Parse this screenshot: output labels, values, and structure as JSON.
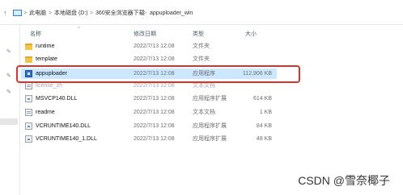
{
  "breadcrumb": [
    "此电脑",
    "本地磁盘 (D:)",
    "360安全浏览器下载",
    "appuploader_win"
  ],
  "breadcrumb_separator": ">",
  "columns": {
    "name": "名称",
    "date": "修改日期",
    "type": "类型",
    "size": "大小"
  },
  "files": [
    {
      "name": "runtime",
      "date": "2022/7/13 12:08",
      "type": "文件夹",
      "size": "",
      "icon": "folder-icon"
    },
    {
      "name": "template",
      "date": "2022/7/13 12:08",
      "type": "文件夹",
      "size": "",
      "icon": "folder-icon"
    },
    {
      "name": "appuploader",
      "date": "2022/7/13 12:08",
      "type": "应用程序",
      "size": "112,906 KB",
      "icon": "application-icon",
      "selected": true
    },
    {
      "name": "license_zh",
      "date": "2022/7/13 12:08",
      "type": "文本文档",
      "size": "",
      "icon": "text-file-icon",
      "faded": true
    },
    {
      "name": "MSVCP140.DLL",
      "date": "2022/7/13 12:08",
      "type": "应用程序扩展",
      "size": "614 KB",
      "icon": "dll-file-icon"
    },
    {
      "name": "readme",
      "date": "2022/7/13 12:08",
      "type": "文本文档",
      "size": "1 KB",
      "icon": "text-file-icon"
    },
    {
      "name": "VCRUNTIME140.DLL",
      "date": "2022/7/13 12:08",
      "type": "应用程序扩展",
      "size": "84 KB",
      "icon": "dll-file-icon"
    },
    {
      "name": "VCRUNTIME140_1.DLL",
      "date": "2022/7/13 12:08",
      "type": "应用程序扩展",
      "size": "48 KB",
      "icon": "dll-file-icon"
    }
  ],
  "watermark": "CSDN @雪奈椰子",
  "colors": {
    "selection": "#cce8ff",
    "highlight_box": "#d9322c",
    "folder": "#f3c64a"
  }
}
